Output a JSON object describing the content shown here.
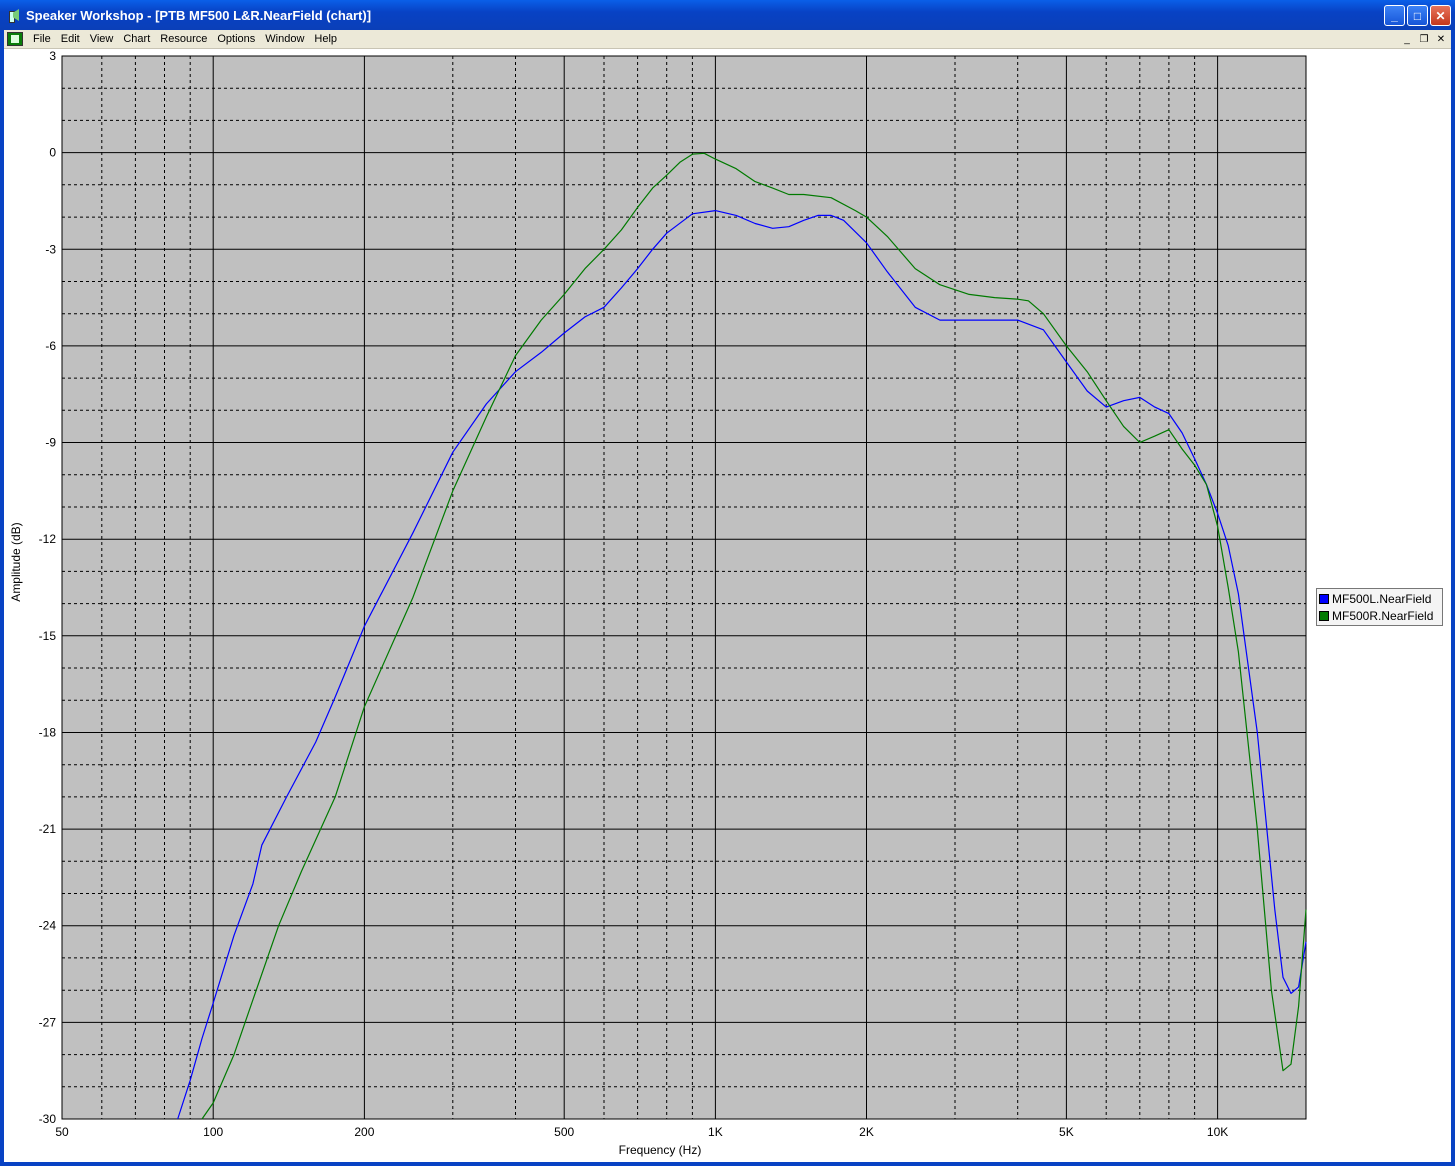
{
  "window": {
    "title": "Speaker Workshop - [PTB MF500 L&R.NearField (chart)]",
    "minimize_label": "_",
    "maximize_label": "□",
    "close_label": "✕"
  },
  "menubar": {
    "items": [
      "File",
      "Edit",
      "View",
      "Chart",
      "Resource",
      "Options",
      "Window",
      "Help"
    ],
    "mdi_minimize": "_",
    "mdi_restore": "❐",
    "mdi_close": "✕"
  },
  "colors": {
    "plot_bg": "#c0c0c0",
    "grid": "#000000",
    "series_left": "#0000ff",
    "series_right": "#007a00"
  },
  "chart_data": {
    "type": "line",
    "xlabel": "Frequency (Hz)",
    "ylabel": "Amplitude (dB)",
    "x_scale": "log",
    "xlim": [
      50,
      15000
    ],
    "ylim": [
      -30,
      3
    ],
    "x_ticks": [
      {
        "value": 50,
        "label": "50"
      },
      {
        "value": 100,
        "label": "100"
      },
      {
        "value": 200,
        "label": "200"
      },
      {
        "value": 500,
        "label": "500"
      },
      {
        "value": 1000,
        "label": "1K"
      },
      {
        "value": 2000,
        "label": "2K"
      },
      {
        "value": 5000,
        "label": "5K"
      },
      {
        "value": 10000,
        "label": "10K"
      }
    ],
    "y_ticks": [
      3,
      0,
      -3,
      -6,
      -9,
      -12,
      -15,
      -18,
      -21,
      -24,
      -27,
      -30
    ],
    "grid": true,
    "legend_position": "right",
    "series": [
      {
        "name": "MF500L.NearField",
        "color": "#0000ff",
        "points": [
          [
            85,
            -30
          ],
          [
            90,
            -28.8
          ],
          [
            95,
            -27.5
          ],
          [
            100,
            -26.4
          ],
          [
            110,
            -24.3
          ],
          [
            120,
            -22.7
          ],
          [
            125,
            -21.5
          ],
          [
            140,
            -20.0
          ],
          [
            160,
            -18.3
          ],
          [
            175,
            -16.9
          ],
          [
            200,
            -14.7
          ],
          [
            250,
            -11.8
          ],
          [
            300,
            -9.3
          ],
          [
            350,
            -7.8
          ],
          [
            400,
            -6.8
          ],
          [
            450,
            -6.2
          ],
          [
            500,
            -5.6
          ],
          [
            550,
            -5.1
          ],
          [
            600,
            -4.8
          ],
          [
            650,
            -4.2
          ],
          [
            700,
            -3.6
          ],
          [
            750,
            -3.0
          ],
          [
            800,
            -2.5
          ],
          [
            900,
            -1.9
          ],
          [
            1000,
            -1.8
          ],
          [
            1100,
            -1.95
          ],
          [
            1200,
            -2.2
          ],
          [
            1300,
            -2.35
          ],
          [
            1400,
            -2.3
          ],
          [
            1500,
            -2.1
          ],
          [
            1600,
            -1.95
          ],
          [
            1700,
            -1.95
          ],
          [
            1800,
            -2.1
          ],
          [
            2000,
            -2.8
          ],
          [
            2200,
            -3.7
          ],
          [
            2500,
            -4.8
          ],
          [
            2800,
            -5.2
          ],
          [
            3000,
            -5.2
          ],
          [
            3500,
            -5.2
          ],
          [
            4000,
            -5.2
          ],
          [
            4500,
            -5.5
          ],
          [
            5000,
            -6.5
          ],
          [
            5500,
            -7.4
          ],
          [
            6000,
            -7.9
          ],
          [
            6500,
            -7.7
          ],
          [
            7000,
            -7.6
          ],
          [
            7500,
            -7.9
          ],
          [
            8000,
            -8.1
          ],
          [
            8500,
            -8.7
          ],
          [
            9000,
            -9.5
          ],
          [
            9500,
            -10.3
          ],
          [
            10000,
            -11.2
          ],
          [
            10500,
            -12.2
          ],
          [
            11000,
            -13.7
          ],
          [
            12000,
            -18.0
          ],
          [
            13000,
            -23.5
          ],
          [
            13500,
            -25.6
          ],
          [
            14000,
            -26.1
          ],
          [
            14500,
            -25.9
          ],
          [
            15000,
            -24.5
          ]
        ]
      },
      {
        "name": "MF500R.NearField",
        "color": "#007a00",
        "points": [
          [
            95,
            -30
          ],
          [
            100,
            -29.5
          ],
          [
            110,
            -28.0
          ],
          [
            120,
            -26.3
          ],
          [
            135,
            -24.0
          ],
          [
            150,
            -22.3
          ],
          [
            175,
            -20.0
          ],
          [
            200,
            -17.2
          ],
          [
            250,
            -13.8
          ],
          [
            300,
            -10.5
          ],
          [
            350,
            -8.2
          ],
          [
            400,
            -6.3
          ],
          [
            450,
            -5.2
          ],
          [
            500,
            -4.4
          ],
          [
            550,
            -3.6
          ],
          [
            600,
            -3.0
          ],
          [
            650,
            -2.4
          ],
          [
            700,
            -1.7
          ],
          [
            750,
            -1.1
          ],
          [
            800,
            -0.7
          ],
          [
            850,
            -0.3
          ],
          [
            900,
            -0.05
          ],
          [
            950,
            -0.02
          ],
          [
            1000,
            -0.2
          ],
          [
            1100,
            -0.5
          ],
          [
            1200,
            -0.9
          ],
          [
            1300,
            -1.1
          ],
          [
            1400,
            -1.3
          ],
          [
            1500,
            -1.3
          ],
          [
            1700,
            -1.4
          ],
          [
            1900,
            -1.8
          ],
          [
            2000,
            -2.0
          ],
          [
            2200,
            -2.6
          ],
          [
            2500,
            -3.6
          ],
          [
            2800,
            -4.1
          ],
          [
            3200,
            -4.4
          ],
          [
            3600,
            -4.5
          ],
          [
            4000,
            -4.55
          ],
          [
            4200,
            -4.6
          ],
          [
            4500,
            -5.0
          ],
          [
            5000,
            -6.0
          ],
          [
            5500,
            -6.8
          ],
          [
            6000,
            -7.7
          ],
          [
            6500,
            -8.5
          ],
          [
            7000,
            -9.0
          ],
          [
            7500,
            -8.8
          ],
          [
            8000,
            -8.6
          ],
          [
            8500,
            -9.2
          ],
          [
            9000,
            -9.7
          ],
          [
            9500,
            -10.3
          ],
          [
            10000,
            -11.6
          ],
          [
            10500,
            -13.5
          ],
          [
            11000,
            -15.5
          ],
          [
            12000,
            -21.0
          ],
          [
            12800,
            -26.0
          ],
          [
            13500,
            -28.5
          ],
          [
            14000,
            -28.3
          ],
          [
            14500,
            -26.5
          ],
          [
            15000,
            -23.5
          ]
        ]
      }
    ]
  }
}
